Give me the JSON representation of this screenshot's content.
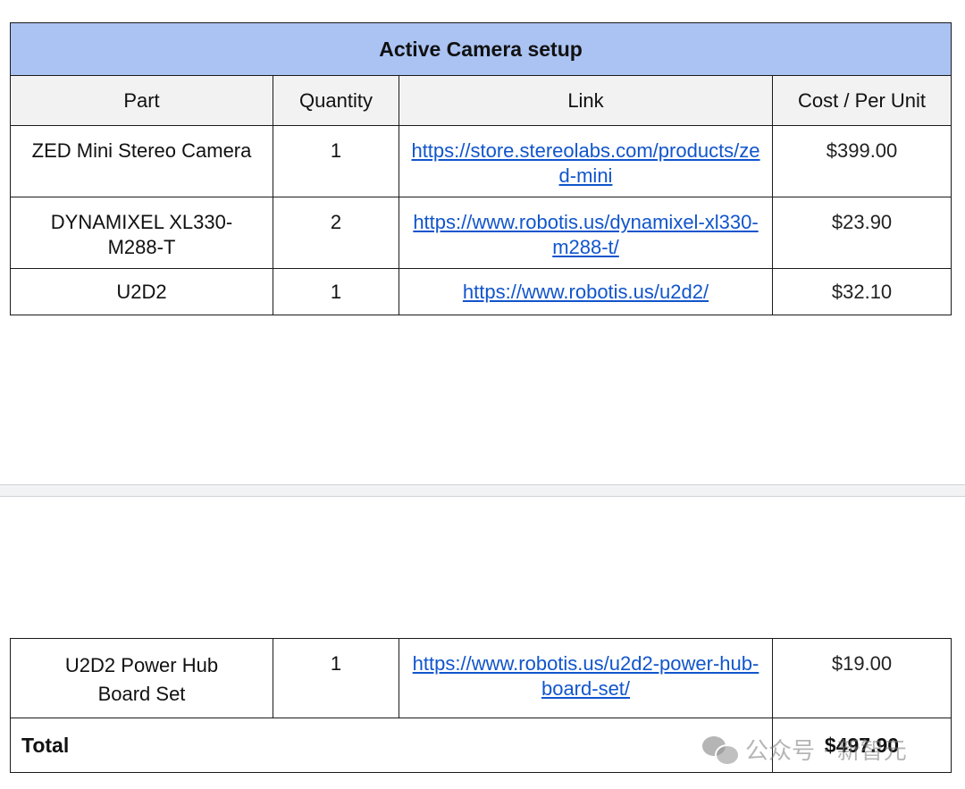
{
  "table": {
    "title": "Active Camera setup",
    "headers": [
      "Part",
      "Quantity",
      "Link",
      "Cost / Per Unit"
    ],
    "rows": [
      {
        "part": "ZED Mini Stereo Camera",
        "quantity": "1",
        "link": "https://store.stereolabs.com/products/zed-mini",
        "cost": "$399.00"
      },
      {
        "part": "DYNAMIXEL XL330-M288-T",
        "quantity": "2",
        "link": "https://www.robotis.us/dynamixel-xl330-m288-t/",
        "cost": "$23.90"
      },
      {
        "part": "U2D2",
        "quantity": "1",
        "link": "https://www.robotis.us/u2d2/",
        "cost": "$32.10"
      },
      {
        "part": "U2D2 Power Hub Board Set",
        "quantity": "1",
        "link": "https://www.robotis.us/u2d2-power-hub-board-set/",
        "cost": "$19.00"
      }
    ],
    "total_label": "Total",
    "total_value": "$497.90"
  },
  "watermark": {
    "text": "公众号 · 新智元",
    "icon": "wechat-icon"
  }
}
